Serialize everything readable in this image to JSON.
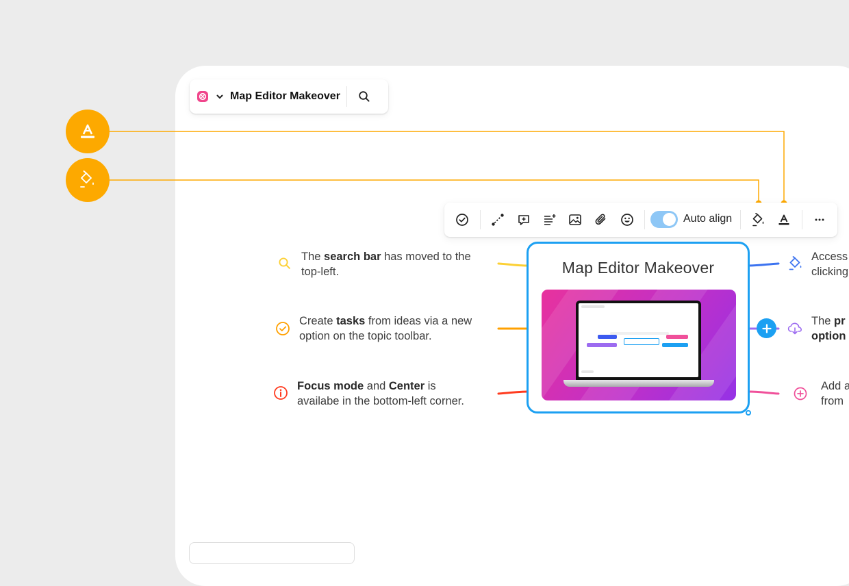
{
  "titlebar": {
    "map_title": "Map Editor Makeover"
  },
  "toolbar": {
    "auto_align_label": "Auto align",
    "auto_align_on": true
  },
  "central_topic": {
    "title": "Map Editor Makeover"
  },
  "notes_left": [
    {
      "pre": "The ",
      "bold1": "search bar",
      "mid": " has moved to the",
      "line2": "top-left."
    },
    {
      "pre": "Create ",
      "bold1": "tasks",
      "mid": " from ideas via a new",
      "line2": "option on the topic toolbar."
    },
    {
      "bold1": "Focus mode",
      "mid": " and ",
      "bold2": "Center",
      "post": " is",
      "line2": "availabe in the bottom-left corner."
    }
  ],
  "notes_right": [
    {
      "line1": "Access",
      "line2": "clicking"
    },
    {
      "line1_pre": "The ",
      "line1_bold": "pr",
      "line2_bold": "option"
    },
    {
      "line1": "Add a",
      "line2": "from"
    }
  ],
  "colors": {
    "accent_orange": "#fda900",
    "selection_blue": "#1ca0f2",
    "branch_yellow": "#fcd034",
    "branch_orange": "#ffa000",
    "branch_red": "#ff3b1f",
    "branch_blue": "#3c73f0",
    "branch_purple": "#9c6bf0",
    "branch_pink": "#f0509a"
  },
  "icons": {
    "callouts": [
      "text-style-icon",
      "paint-bucket-icon"
    ],
    "toolbar": [
      "task-check-icon",
      "relationship-icon",
      "comment-icon",
      "notes-icon",
      "image-icon",
      "attachment-icon",
      "emoji-icon",
      "paint-bucket-icon",
      "text-style-icon",
      "more-icon"
    ]
  }
}
